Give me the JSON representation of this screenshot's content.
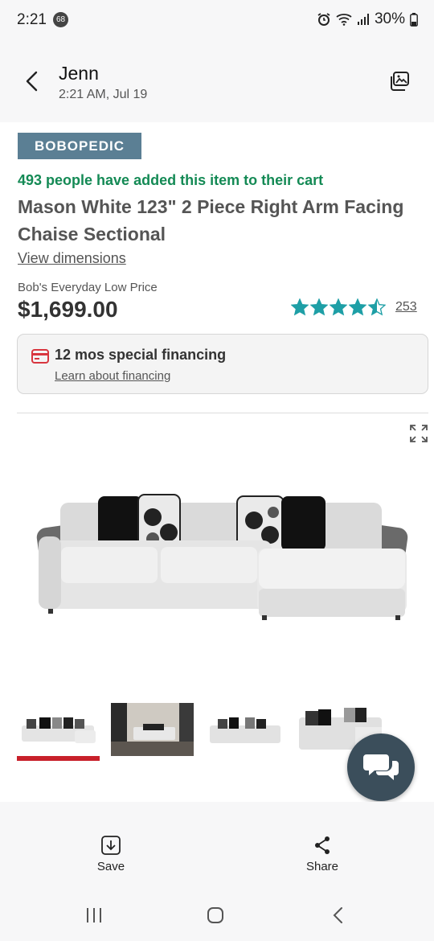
{
  "status": {
    "time": "2:21",
    "notification_count": "68",
    "battery": "30%"
  },
  "header": {
    "sender": "Jenn",
    "timestamp": "2:21 AM, Jul 19"
  },
  "product": {
    "brand": "BOBOPEDIC",
    "cart_message": "493 people have added this item to their cart",
    "title": "Mason White 123\" 2 Piece Right Arm Facing Chaise Sectional",
    "dimensions_link": "View dimensions",
    "price_label": "Bob's Everyday Low Price",
    "price": "$1,699.00",
    "rating": 4.5,
    "review_count": "253",
    "financing_title": "12 mos special financing",
    "financing_link": "Learn about financing"
  },
  "thumbnails": {
    "count": 4,
    "selected_index": 0
  },
  "actions": {
    "save_label": "Save",
    "share_label": "Share"
  },
  "colors": {
    "accent_green": "#148a55",
    "star_teal": "#1e9fa6",
    "active_red": "#c8202a",
    "brand_blue": "#5b7f94"
  }
}
